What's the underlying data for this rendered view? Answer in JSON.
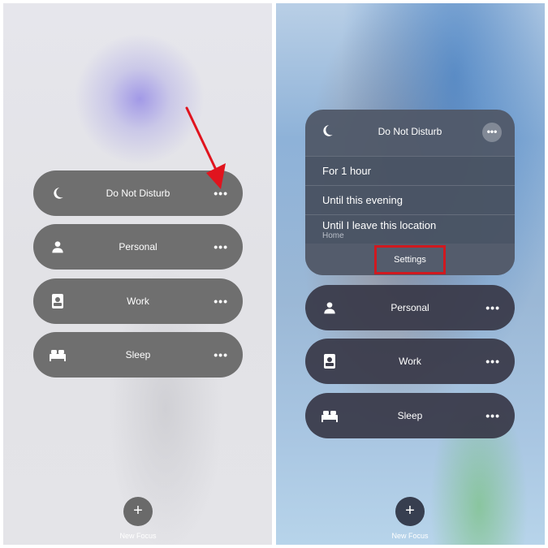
{
  "left": {
    "focus_items": [
      {
        "label": "Do Not Disturb",
        "icon": "moon-icon",
        "more": "•••"
      },
      {
        "label": "Personal",
        "icon": "person-icon",
        "more": "•••"
      },
      {
        "label": "Work",
        "icon": "id-badge-icon",
        "more": "•••"
      },
      {
        "label": "Sleep",
        "icon": "bed-icon",
        "more": "•••"
      }
    ],
    "new_focus": {
      "plus": "+",
      "label": "New Focus"
    },
    "annotation_color": "#e0141e"
  },
  "right": {
    "dnd": {
      "label": "Do Not Disturb",
      "icon": "moon-icon",
      "more": "•••",
      "options": [
        {
          "label": "For 1 hour"
        },
        {
          "label": "Until this evening"
        },
        {
          "label": "Until I leave this location",
          "sublabel": "Home"
        }
      ],
      "settings_label": "Settings",
      "highlight_color": "#d0191f"
    },
    "focus_items": [
      {
        "label": "Personal",
        "icon": "person-icon",
        "more": "•••"
      },
      {
        "label": "Work",
        "icon": "id-badge-icon",
        "more": "•••"
      },
      {
        "label": "Sleep",
        "icon": "bed-icon",
        "more": "•••"
      }
    ],
    "new_focus": {
      "plus": "+",
      "label": "New Focus"
    }
  }
}
